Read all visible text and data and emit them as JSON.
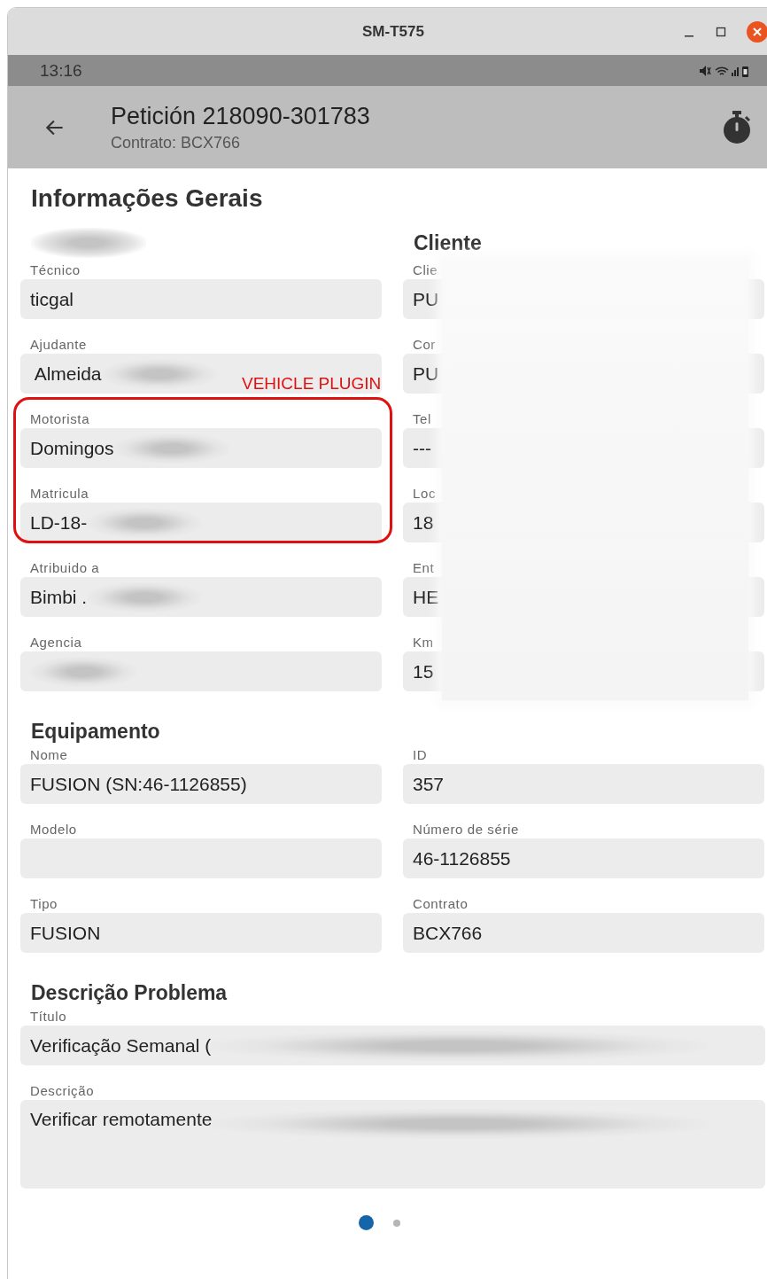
{
  "window": {
    "title": "SM-T575"
  },
  "status_bar": {
    "time": "13:16"
  },
  "app_bar": {
    "title": "Petición 218090-301783",
    "subtitle": "Contrato: BCX766"
  },
  "general": {
    "title": "Informações Gerais",
    "left": {
      "fields": [
        {
          "label": "Técnico",
          "value": "ticgal",
          "redacted": false
        },
        {
          "label": "Ajudante",
          "value": " Almeida",
          "redacted": true
        },
        {
          "label": "Motorista",
          "value": "Domingos",
          "redacted": true
        },
        {
          "label": "Matricula",
          "value": "LD-18-",
          "redacted": true
        },
        {
          "label": "Atribuido a",
          "value": "Bimbi .",
          "redacted": true
        },
        {
          "label": "Agencia",
          "redacted": true
        }
      ]
    },
    "right": {
      "heading": "Cliente",
      "redacted": true,
      "fields": [
        {
          "label": "Clie",
          "value": "PU"
        },
        {
          "label": "Cor",
          "value": "PU"
        },
        {
          "label": "Tel",
          "value": "---"
        },
        {
          "label": "Loc",
          "value": "18"
        },
        {
          "label": "Ent",
          "value": "HE"
        },
        {
          "label": "Km",
          "value": "15"
        }
      ]
    }
  },
  "annotation": {
    "label": "VEHICLE PLUGIN"
  },
  "equipment": {
    "title": "Equipamento",
    "fields": [
      {
        "label": "Nome",
        "value": "FUSION (SN:46-1126855)"
      },
      {
        "label": "ID",
        "value": "357"
      },
      {
        "label": "Modelo"
      },
      {
        "label": "Número de série",
        "value": "46-1126855"
      },
      {
        "label": "Tipo",
        "value": "FUSION"
      },
      {
        "label": "Contrato",
        "value": "BCX766"
      }
    ]
  },
  "problem": {
    "title": "Descrição Problema",
    "fields": [
      {
        "kind": "line",
        "label": "Título",
        "value": "Verificação Semanal (",
        "redacted": true
      },
      {
        "kind": "area",
        "label": "Descrição",
        "value": "Verificar remotamente",
        "redacted": true
      }
    ]
  },
  "pager": [
    {
      "selected": true
    },
    {
      "selected": false
    }
  ]
}
